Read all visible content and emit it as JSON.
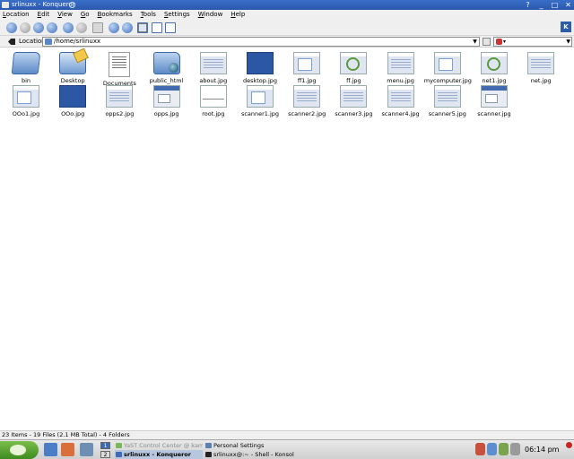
{
  "window": {
    "title": "srlinuxx - Konqueror",
    "controls": [
      "?",
      "_",
      "□",
      "✕"
    ]
  },
  "menubar": {
    "items": [
      "Location",
      "Edit",
      "View",
      "Go",
      "Bookmarks",
      "Tools",
      "Settings",
      "Window",
      "Help"
    ]
  },
  "toolbar": {
    "buttons": [
      "back-icon",
      "reload-icon",
      "forward-icon",
      "up-icon",
      "home-icon",
      "stop-icon",
      "print-icon",
      "zoom-in-icon",
      "zoom-out-icon",
      "icon-view-icon",
      "detailed-view-icon",
      "text-view-icon"
    ]
  },
  "location": {
    "label": "Location:",
    "value": "/home/srlinuxx"
  },
  "files": [
    {
      "name": "bin",
      "kind": "folder-bin"
    },
    {
      "name": "Desktop",
      "kind": "folder-desktop"
    },
    {
      "name": "Documents",
      "kind": "doc"
    },
    {
      "name": "public_html",
      "kind": "folder-public"
    },
    {
      "name": "about.jpg",
      "kind": "shot-lines"
    },
    {
      "name": "desktop.jpg",
      "kind": "shot-dark"
    },
    {
      "name": "ff1.jpg",
      "kind": "shot-win"
    },
    {
      "name": "ff.jpg",
      "kind": "shot-green"
    },
    {
      "name": "menu.jpg",
      "kind": "shot-lines"
    },
    {
      "name": "mycomputer.jpg",
      "kind": "shot-win"
    },
    {
      "name": "net1.jpg",
      "kind": "shot-green"
    },
    {
      "name": "net.jpg",
      "kind": "shot-lines"
    },
    {
      "name": "OOo1.jpg",
      "kind": "shot-win"
    },
    {
      "name": "OOo.jpg",
      "kind": "shot-dark"
    },
    {
      "name": "opps2.jpg",
      "kind": "shot-lines"
    },
    {
      "name": "opps.jpg",
      "kind": "shot-dlg"
    },
    {
      "name": "root.jpg",
      "kind": "shot-white"
    },
    {
      "name": "scanner1.jpg",
      "kind": "shot-win"
    },
    {
      "name": "scanner2.jpg",
      "kind": "shot-lines"
    },
    {
      "name": "scanner3.jpg",
      "kind": "shot-lines"
    },
    {
      "name": "scanner4.jpg",
      "kind": "shot-lines"
    },
    {
      "name": "scanner5.jpg",
      "kind": "shot-lines"
    },
    {
      "name": "scanner.jpg",
      "kind": "shot-dlg"
    }
  ],
  "status": {
    "text": "23 Items - 19 Files (2.1 MB Total) - 4 Folders"
  },
  "taskbar": {
    "pager": [
      "1",
      "2"
    ],
    "tasks": [
      {
        "label": "YaST Control Center @ kamm",
        "state": "dim"
      },
      {
        "label": "srlinuxx - Konqueror",
        "state": "active"
      },
      {
        "label": "Personal Settings",
        "state": "normal"
      },
      {
        "label": "srlinuxx@:~ - Shell - Konsole",
        "state": "normal"
      }
    ],
    "clock": "06:14 pm"
  },
  "colors": {
    "titlebar": "#2f62b9",
    "menubar": "#efefef",
    "kmenu": "#4f9e2c",
    "selection": "#b8c6de"
  }
}
